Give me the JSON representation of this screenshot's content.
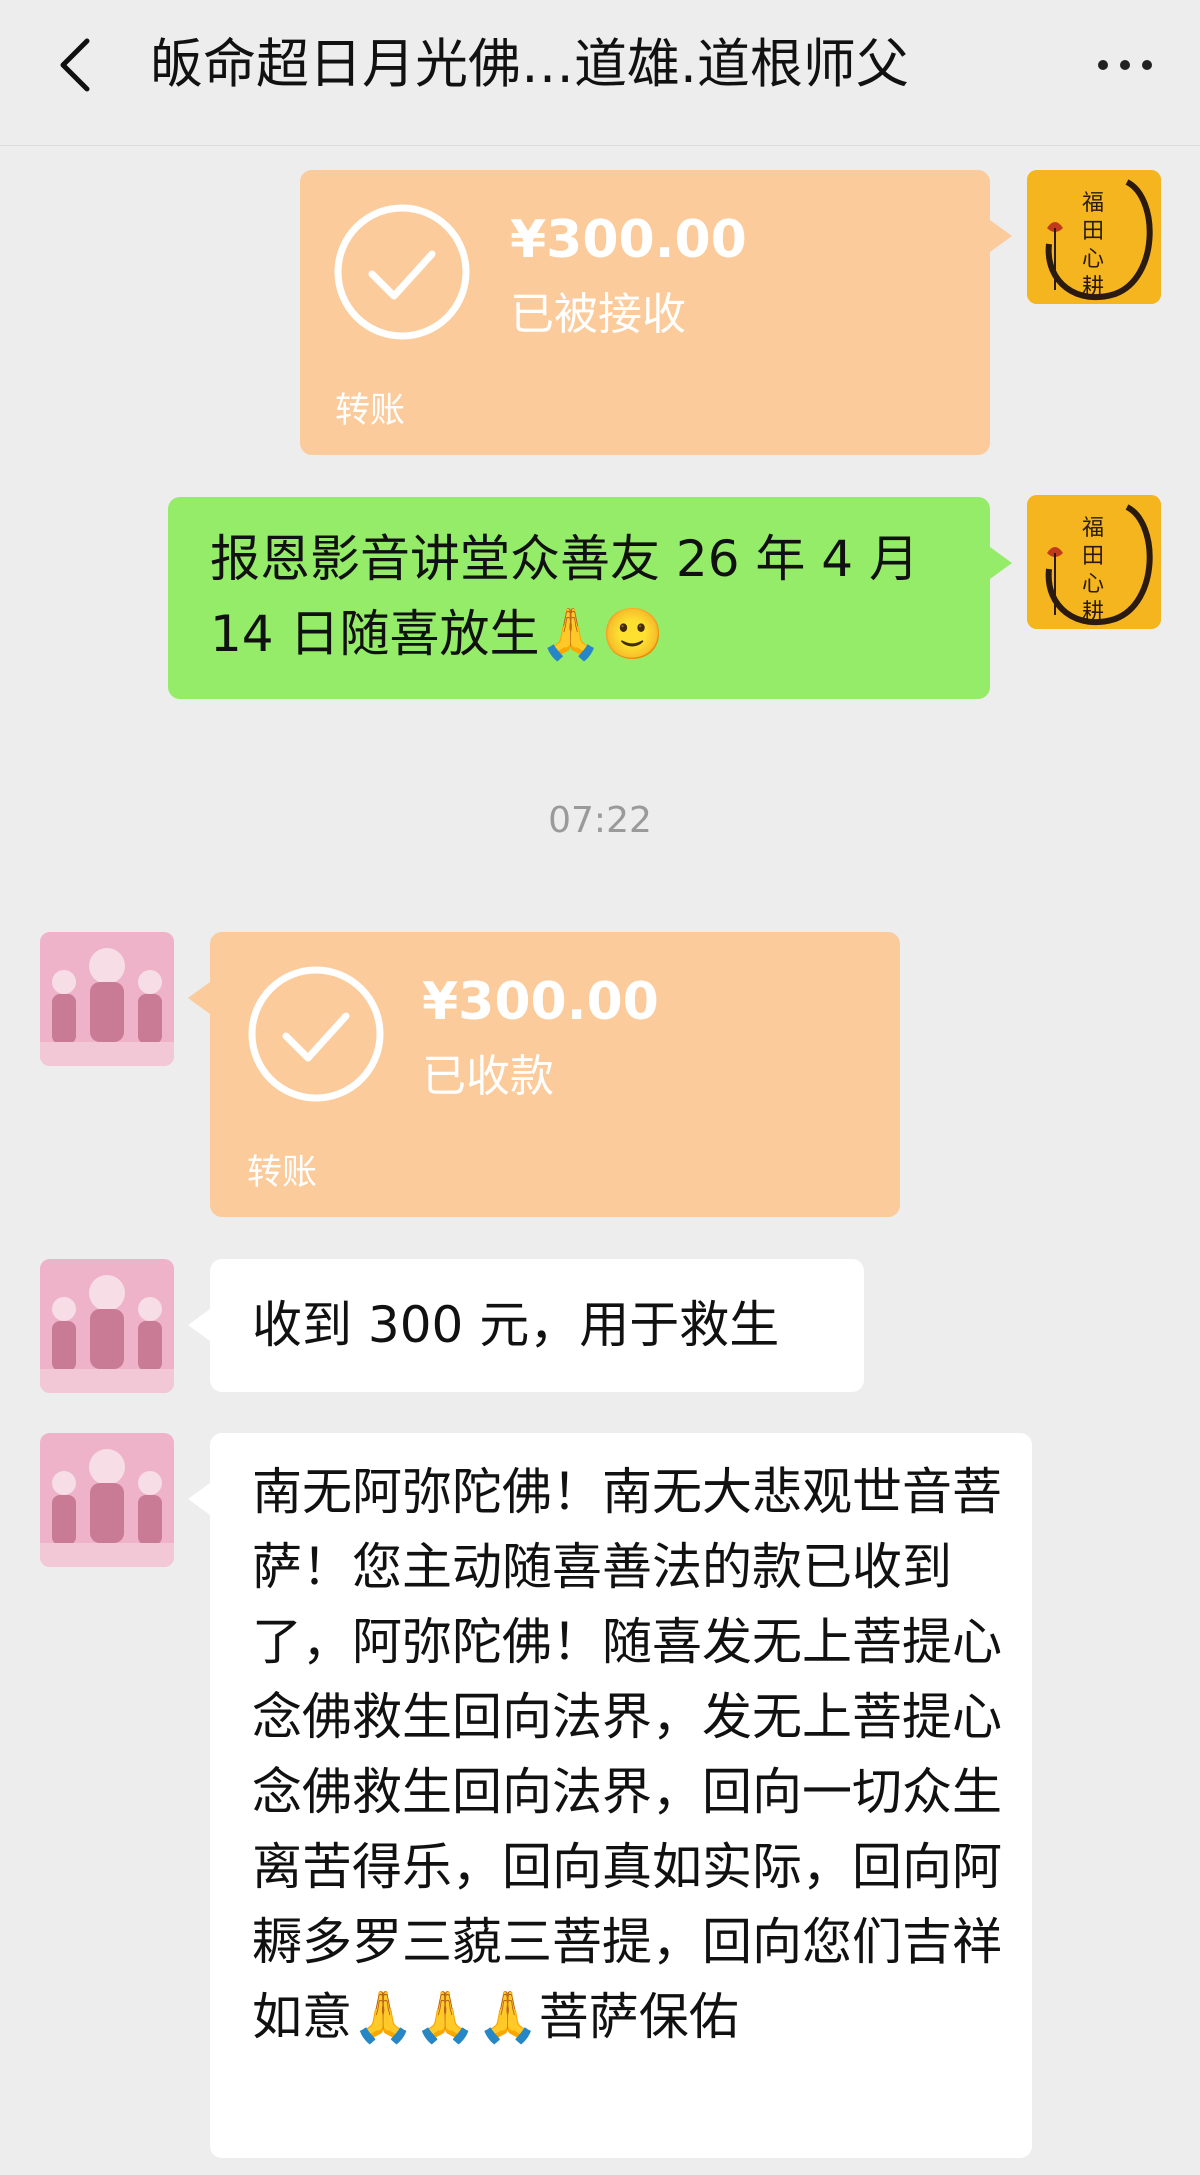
{
  "header": {
    "title": "皈命超日月光佛…道雄.道根师父",
    "back_icon": "chevron-left-icon",
    "more_icon": "more-dots-icon"
  },
  "messages": {
    "m1": {
      "sender": "self",
      "type": "transfer",
      "amount": "¥300.00",
      "status": "已被接收",
      "label": "转账",
      "avatar_text": "福田心耕"
    },
    "m2": {
      "sender": "self",
      "type": "text",
      "text": "报恩影音讲堂众善友 26 年 4 月 14 日随喜放生🙏🙂"
    },
    "timestamp": "07:22",
    "m3": {
      "sender": "other",
      "type": "transfer",
      "amount": "¥300.00",
      "status": "已收款",
      "label": "转账"
    },
    "m4": {
      "sender": "other",
      "type": "text",
      "text": "收到 300 元，用于救生"
    },
    "m5": {
      "sender": "other",
      "type": "text",
      "text": "南无阿弥陀佛！南无大悲观世音菩萨！您主动随喜善法的款已收到了，阿弥陀佛！随喜发无上菩提心念佛救生回向法界，发无上菩提心念佛救生回向法界，回向一切众生离苦得乐，回向真如实际，回向阿耨多罗三藐三菩提，回向您们吉祥如意🙏🙏🙏菩萨保佑"
    }
  },
  "colors": {
    "background": "#ededed",
    "transfer_bubble": "#fbcb9b",
    "self_text_bubble": "#95ec69",
    "other_text_bubble": "#ffffff",
    "self_avatar": "#f4b51e"
  }
}
